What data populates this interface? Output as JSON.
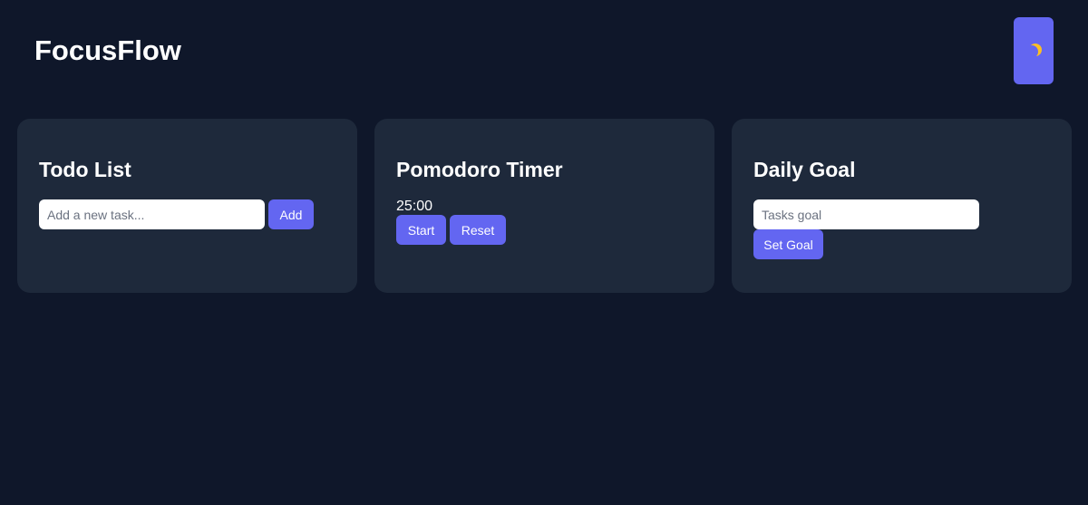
{
  "app": {
    "title": "FocusFlow"
  },
  "theme_toggle": {
    "icon": "moon-icon",
    "color": "#6366f1"
  },
  "colors": {
    "background": "#0f172a",
    "card": "#1e293b",
    "accent": "#6366f1"
  },
  "todo": {
    "title": "Todo List",
    "input_placeholder": "Add a new task...",
    "input_value": "",
    "add_label": "Add"
  },
  "pomodoro": {
    "title": "Pomodoro Timer",
    "time": "25:00",
    "start_label": "Start",
    "reset_label": "Reset"
  },
  "daily_goal": {
    "title": "Daily Goal",
    "input_placeholder": "Tasks goal",
    "input_value": "",
    "set_label": "Set Goal"
  }
}
